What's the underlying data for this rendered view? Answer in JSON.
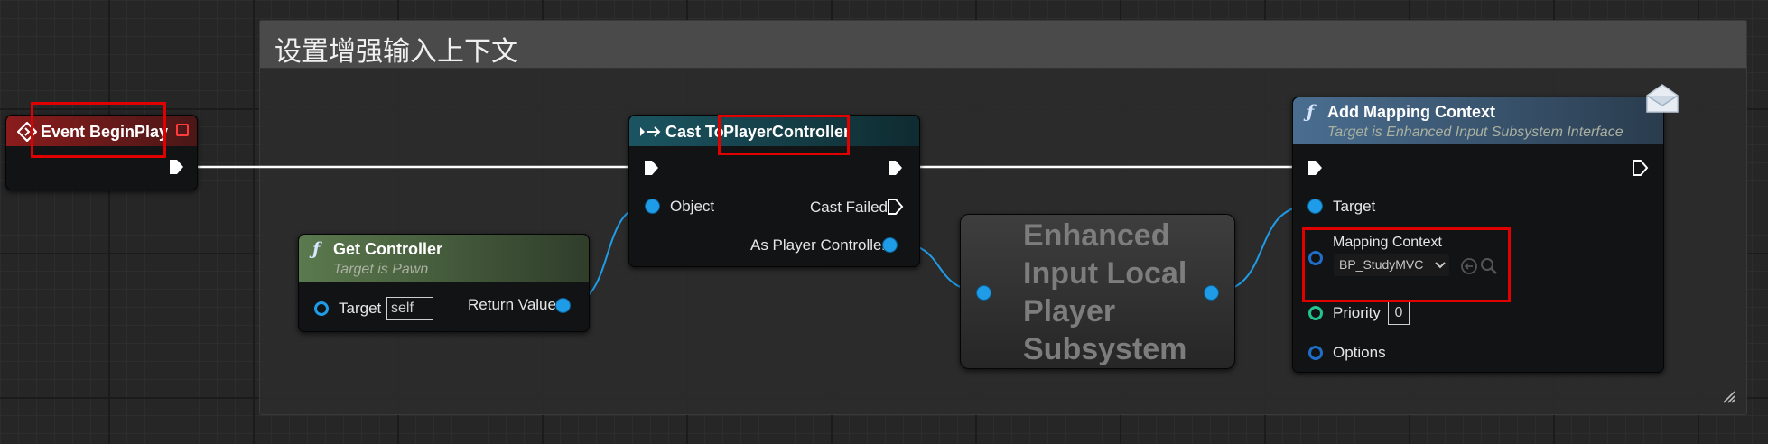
{
  "comment": {
    "title": "设置增强输入上下文"
  },
  "nodes": {
    "begin_play": {
      "title": "Event BeginPlay"
    },
    "get_controller": {
      "title": "Get Controller",
      "subtitle": "Target is Pawn",
      "target_label": "Target",
      "target_value": "self",
      "return_label": "Return Value"
    },
    "cast": {
      "title_prefix": "Cast To",
      "title_class": "PlayerController",
      "object_label": "Object",
      "cast_failed_label": "Cast Failed",
      "as_label": "As Player Controller"
    },
    "subsystem": {
      "title_lines": [
        "Enhanced",
        "Input Local",
        "Player",
        "Subsystem"
      ]
    },
    "add_mapping": {
      "title": "Add Mapping Context",
      "subtitle": "Target is Enhanced Input Subsystem Interface",
      "target_label": "Target",
      "mapping_label": "Mapping Context",
      "mapping_value": "BP_StudyMVC",
      "priority_label": "Priority",
      "priority_value": "0",
      "options_label": "Options"
    }
  },
  "colors": {
    "exec_wire": "#ffffff",
    "object_wire": "#1f9ce8",
    "event_header": "#8b1c1c",
    "pure_header": "#5b7a4e",
    "cast_header": "#16454f",
    "func_header": "#3f5f7d",
    "highlight": "#e00000"
  },
  "icons": [
    "event-diamond-icon",
    "function-icon",
    "cast-arrow-icon",
    "message-envelope-icon",
    "exec-pin-icon",
    "object-pin-icon",
    "dropdown-chevron-icon",
    "use-selected-icon",
    "browse-search-icon",
    "resize-grip-icon"
  ]
}
